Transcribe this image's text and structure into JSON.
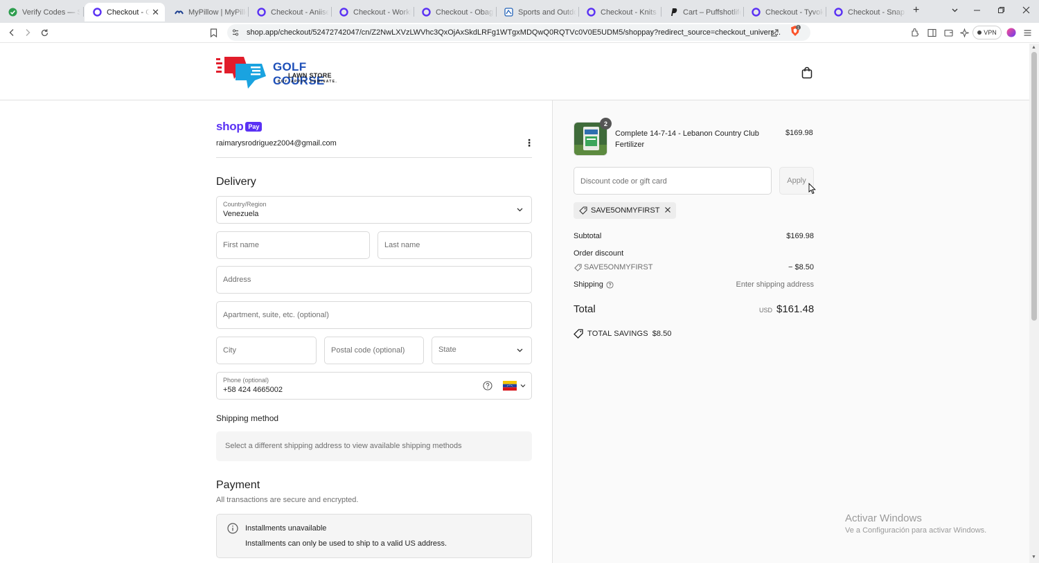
{
  "browser": {
    "tabs": [
      {
        "title": "Verify Codes — Sim",
        "active": false
      },
      {
        "title": "Checkout - Golf",
        "active": true
      },
      {
        "title": "MyPillow | MyPillow",
        "active": false
      },
      {
        "title": "Checkout - Aniise",
        "active": false
      },
      {
        "title": "Checkout - WorkIT",
        "active": false
      },
      {
        "title": "Checkout - Obagi",
        "active": false
      },
      {
        "title": "Sports and Outdoor",
        "active": false
      },
      {
        "title": "Checkout - Knits and",
        "active": false
      },
      {
        "title": "Cart – Puffshotlife",
        "active": false
      },
      {
        "title": "Checkout - Tyvok",
        "active": false
      },
      {
        "title": "Checkout - Snap Ci",
        "active": false
      }
    ],
    "url": "shop.app/checkout/52472742047/cn/Z2NwLXVzLWVhc3QxOjAxSkdLRFg1WTgxMDQwQ0RQTVc0V0E5UDM5/shoppay?redirect_source=checkout_univers...",
    "shield_count": "1",
    "vpn_label": "VPN"
  },
  "store": {
    "logo_line1": "GOLF COURSE",
    "logo_line2": "LAWN STORE",
    "logo_line3": "BUY. APPLY. DOMINATE."
  },
  "shop_pay": {
    "word": "shop",
    "pay": "Pay",
    "email": "raimarysrodriguez2004@gmail.com"
  },
  "delivery": {
    "title": "Delivery",
    "country_label": "Country/Region",
    "country_value": "Venezuela",
    "first_name_ph": "First name",
    "last_name_ph": "Last name",
    "address_ph": "Address",
    "apartment_ph": "Apartment, suite, etc. (optional)",
    "city_ph": "City",
    "postal_ph": "Postal code (optional)",
    "state_ph": "State",
    "phone_label": "Phone (optional)",
    "phone_value": "+58 424 4665002"
  },
  "shipping_method": {
    "title": "Shipping method",
    "message": "Select a different shipping address to view available shipping methods"
  },
  "payment": {
    "title": "Payment",
    "subtitle": "All transactions are secure and encrypted.",
    "notice_title": "Installments unavailable",
    "notice_body": "Installments can only be used to ship to a valid US address."
  },
  "order": {
    "item_qty": "2",
    "item_name": "Complete 14-7-14 - Lebanon Country Club Fertilizer",
    "item_price": "$169.98",
    "discount_ph": "Discount code or gift card",
    "apply_label": "Apply",
    "applied_code": "SAVE5ONMYFIRST",
    "subtotal_label": "Subtotal",
    "subtotal_value": "$169.98",
    "order_discount_label": "Order discount",
    "discount_code": "SAVE5ONMYFIRST",
    "discount_value": "− $8.50",
    "shipping_label": "Shipping",
    "shipping_value": "Enter shipping address",
    "total_label": "Total",
    "total_currency": "USD",
    "total_value": "$161.48",
    "savings_label": "TOTAL SAVINGS",
    "savings_value": "$8.50"
  },
  "windows_watermark": {
    "line1": "Activar Windows",
    "line2": "Ve a Configuración para activar Windows."
  }
}
